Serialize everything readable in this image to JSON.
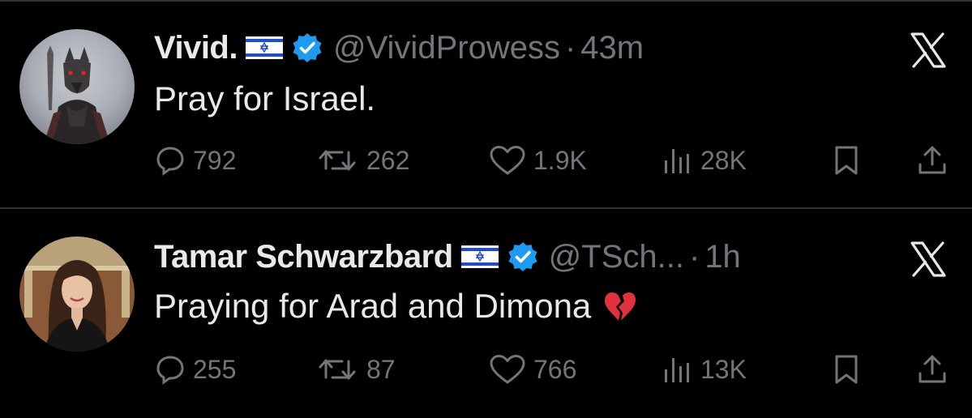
{
  "tweets": [
    {
      "name": "Vivid.",
      "handle": "@VividProwess",
      "separator": "·",
      "time": "43m",
      "text": "Pray for Israel.",
      "stats": {
        "replies": "792",
        "reposts": "262",
        "likes": "1.9K",
        "views": "28K"
      }
    },
    {
      "name": "Tamar Schwarzbard",
      "handle": "@TSch...",
      "separator": "·",
      "time": "1h",
      "text": "Praying for Arad and Dimona",
      "stats": {
        "replies": "255",
        "reposts": "87",
        "likes": "766",
        "views": "13K"
      }
    }
  ],
  "colors": {
    "background": "#000000",
    "text": "#e7e9ea",
    "muted": "#71767b",
    "verified": "#1d9bf0",
    "divider": "#2f3336"
  },
  "icons": [
    "reply-icon",
    "repost-icon",
    "like-icon",
    "views-icon",
    "bookmark-icon",
    "share-icon",
    "x-logo-icon",
    "verified-badge-icon",
    "israel-flag-icon",
    "broken-heart-icon"
  ]
}
